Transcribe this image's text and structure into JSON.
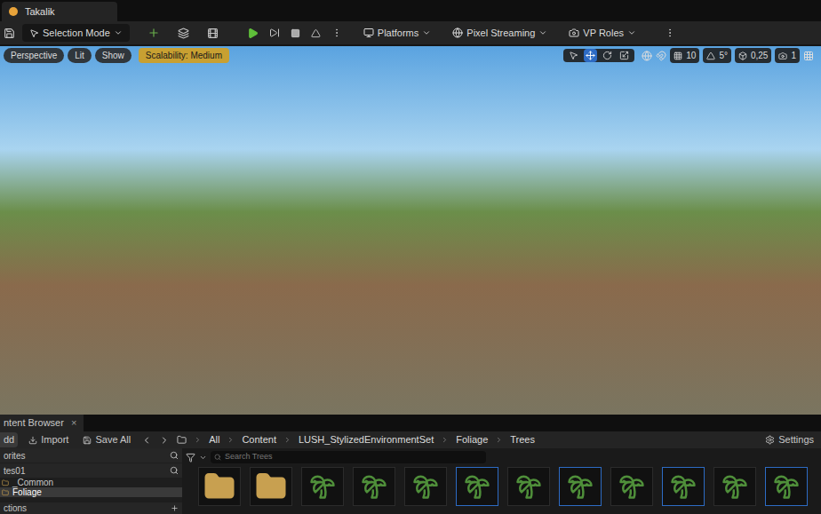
{
  "window": {
    "tab": "Takalik"
  },
  "toolbar": {
    "mode": "Selection Mode",
    "menus": [
      "Platforms",
      "Pixel Streaming",
      "VP Roles"
    ]
  },
  "viewport": {
    "buttons": [
      "Perspective",
      "Lit",
      "Show"
    ],
    "scalability": "Scalability: Medium",
    "tools": [
      {
        "selected": false
      },
      {
        "selected": true
      },
      {
        "selected": false
      },
      {
        "selected": false
      }
    ],
    "snaps": [
      "10",
      "5°",
      "0,25",
      "1"
    ]
  },
  "content_browser": {
    "tab": "ntent Browser",
    "close": "×",
    "actions": [
      "dd",
      "Import",
      "Save All"
    ],
    "breadcrumbs": [
      "All",
      "Content",
      "LUSH_StylizedEnvironmentSet",
      "Foliage",
      "Trees"
    ],
    "settings": "Settings",
    "sidebar": {
      "favorites": "orites",
      "root": "tes01",
      "items": [
        {
          "label": "_Common",
          "selected": false
        },
        {
          "label": "Foliage",
          "selected": true
        }
      ],
      "collections": "ctions"
    },
    "search": {
      "placeholder": "Search Trees"
    },
    "assets": [
      {
        "kind": "folder",
        "color": "#2b2b2b"
      },
      {
        "kind": "folder",
        "color": "#2b2b2b"
      },
      {
        "kind": "tree",
        "color": "#2b2b2b"
      },
      {
        "kind": "tree",
        "color": "#2b2b2b"
      },
      {
        "kind": "tree",
        "color": "#2b2b2b"
      },
      {
        "kind": "tree",
        "color": "#2d6bc4"
      },
      {
        "kind": "tree",
        "color": "#2b2b2b"
      },
      {
        "kind": "tree",
        "color": "#2d6bc4"
      },
      {
        "kind": "tree",
        "color": "#2b2b2b"
      },
      {
        "kind": "tree",
        "color": "#2d6bc4"
      },
      {
        "kind": "tree",
        "color": "#2b2b2b"
      },
      {
        "kind": "tree",
        "color": "#2d6bc4"
      }
    ]
  }
}
